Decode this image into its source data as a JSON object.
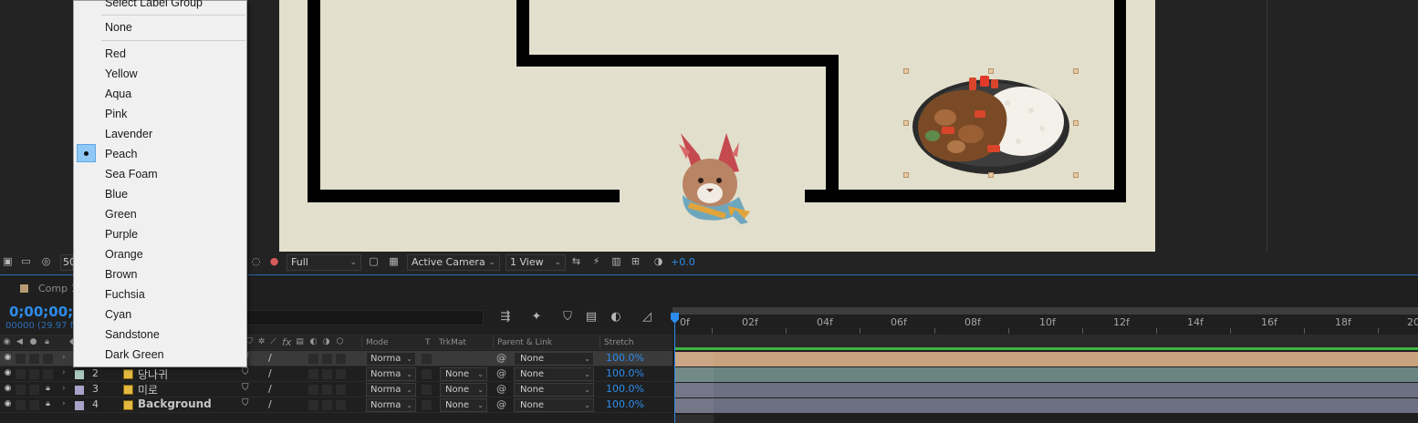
{
  "label_menu": {
    "header": "Select Label Group",
    "none_item": "None",
    "selected": "Peach",
    "items": [
      "Red",
      "Yellow",
      "Aqua",
      "Pink",
      "Lavender",
      "Peach",
      "Sea Foam",
      "Blue",
      "Green",
      "Purple",
      "Orange",
      "Brown",
      "Fuchsia",
      "Cyan",
      "Sandstone",
      "Dark Green"
    ]
  },
  "viewer_toolbar": {
    "zoom": "50",
    "resolution": "Full",
    "camera": "Active Camera",
    "views": "1 View",
    "exposure": "+0.0"
  },
  "timeline": {
    "comp_tab": "Comp 1",
    "timecode": "0;00;00;0",
    "frame_info": "00000 (29.97 fp",
    "ruler_labels": [
      "0f",
      "02f",
      "04f",
      "06f",
      "08f",
      "10f",
      "12f",
      "14f",
      "16f",
      "18f",
      "20"
    ],
    "column_headers": {
      "fx": "fx",
      "mode": "Mode",
      "t": "T",
      "trkmat": "TrkMat",
      "parent": "Parent & Link",
      "stretch": "Stretch"
    },
    "layers": [
      {
        "num": "1",
        "name": "",
        "mode": "Norma",
        "trkmat": "",
        "parent": "None",
        "stretch": "100.0%",
        "label_color": "#b79a72",
        "bar_color": "#c9a27e",
        "locked": false,
        "selected": true
      },
      {
        "num": "2",
        "name": "당나귀",
        "mode": "Norma",
        "trkmat": "None",
        "parent": "None",
        "stretch": "100.0%",
        "label_color": "#a9c7c0",
        "bar_color": "#6a8482",
        "locked": false,
        "selected": false
      },
      {
        "num": "3",
        "name": "미로",
        "mode": "Norma",
        "trkmat": "None",
        "parent": "None",
        "stretch": "100.0%",
        "label_color": "#a7a3c9",
        "bar_color": "#6d6f82",
        "locked": true,
        "selected": false
      },
      {
        "num": "4",
        "name": "Background",
        "mode": "Norma",
        "trkmat": "None",
        "parent": "None",
        "stretch": "100.0%",
        "label_color": "#a7a3c9",
        "bar_color": "#6d6f82",
        "locked": true,
        "selected": false
      }
    ]
  },
  "colors": {
    "accent_blue": "#2d8ceb",
    "canvas_bg": "#e2dfcc",
    "menu_bg": "#f0f0f0",
    "selection_check": "#90c8f6"
  },
  "icons": [
    "eye-icon",
    "lock-icon",
    "caret-right-icon",
    "footage-icon",
    "shy-icon",
    "quality-slash-icon",
    "pickwhip-icon",
    "color-channel-icon",
    "camera-icon",
    "graph-editor-icon"
  ]
}
